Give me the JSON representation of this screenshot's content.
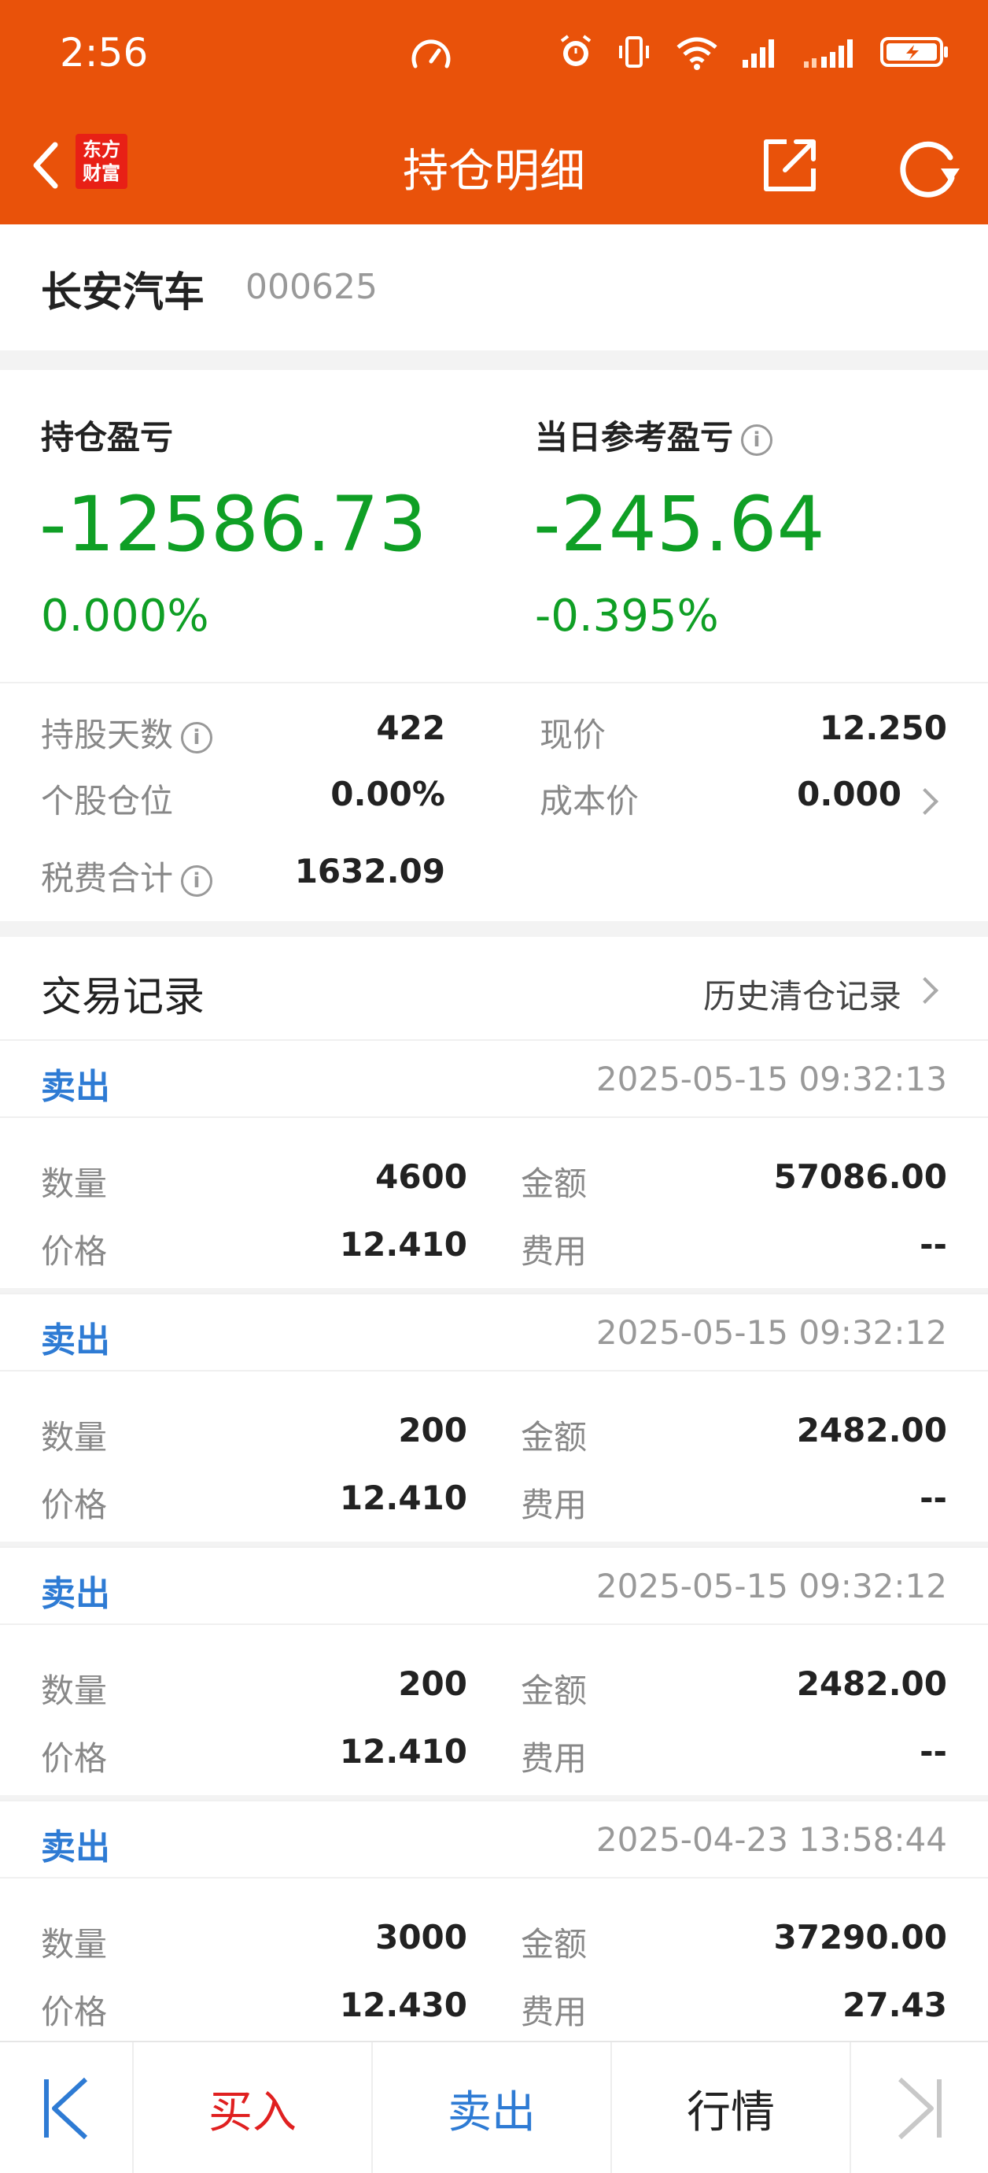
{
  "status": {
    "time": "2:56"
  },
  "header": {
    "title": "持仓明细",
    "logo_line1": "东方",
    "logo_line2": "财富"
  },
  "stock": {
    "name": "长安汽车",
    "code": "000625"
  },
  "summary": {
    "position_pl_label": "持仓盈亏",
    "position_pl_value": "-12586.73",
    "position_pl_pct": "0.000%",
    "daily_pl_label": "当日参考盈亏",
    "daily_pl_value": "-245.64",
    "daily_pl_pct": "-0.395%",
    "hold_days_label": "持股天数",
    "hold_days_value": "422",
    "current_price_label": "现价",
    "current_price_value": "12.250",
    "position_ratio_label": "个股仓位",
    "position_ratio_value": "0.00%",
    "cost_price_label": "成本价",
    "cost_price_value": "0.000",
    "fees_label": "税费合计",
    "fees_value": "1632.09",
    "info_glyph": "i"
  },
  "trades": {
    "title": "交易记录",
    "history_link": "历史清仓记录",
    "labels": {
      "quantity": "数量",
      "amount": "金额",
      "price": "价格",
      "fee": "费用"
    },
    "records": [
      {
        "type": "卖出",
        "time": "2025-05-15 09:32:13",
        "quantity": "4600",
        "amount": "57086.00",
        "price": "12.410",
        "fee": "--"
      },
      {
        "type": "卖出",
        "time": "2025-05-15 09:32:12",
        "quantity": "200",
        "amount": "2482.00",
        "price": "12.410",
        "fee": "--"
      },
      {
        "type": "卖出",
        "time": "2025-05-15 09:32:12",
        "quantity": "200",
        "amount": "2482.00",
        "price": "12.410",
        "fee": "--"
      },
      {
        "type": "卖出",
        "time": "2025-04-23 13:58:44",
        "quantity": "3000",
        "amount": "37290.00",
        "price": "12.430",
        "fee": "27.43"
      }
    ]
  },
  "bottom": {
    "buy": "买入",
    "sell": "卖出",
    "market": "行情"
  },
  "colors": {
    "brand": "#e9520a",
    "loss": "#0f9f25",
    "sell": "#2e7bd4",
    "buy": "#e02020"
  }
}
